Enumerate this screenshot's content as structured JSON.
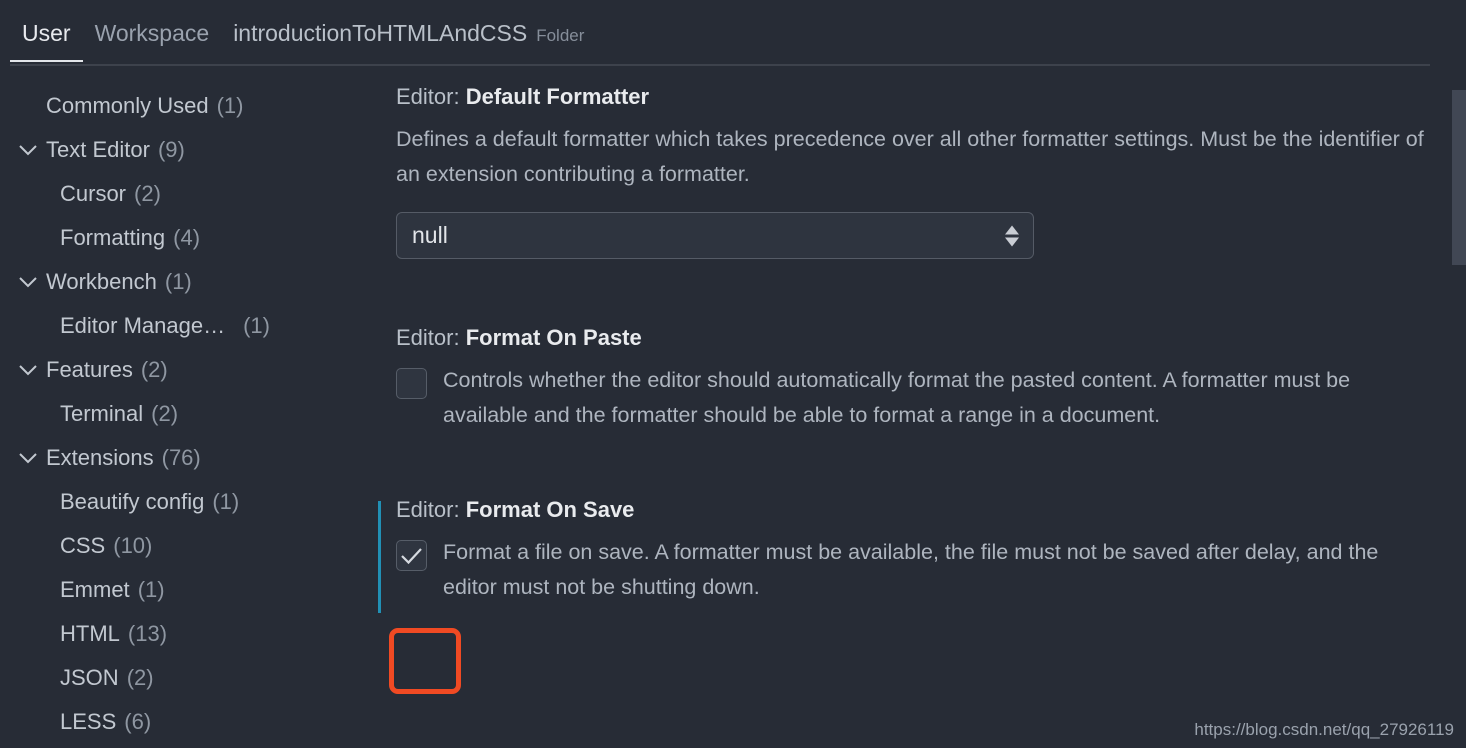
{
  "tabs": [
    {
      "label": "User",
      "active": true,
      "sub": ""
    },
    {
      "label": "Workspace",
      "active": false,
      "sub": ""
    },
    {
      "label": "introductionToHTMLAndCSS",
      "active": false,
      "sub": "Folder"
    }
  ],
  "sidebar": {
    "items": [
      {
        "label": "Commonly Used",
        "count": "(1)",
        "chevron": false,
        "child": false
      },
      {
        "label": "Text Editor",
        "count": "(9)",
        "chevron": true,
        "child": false
      },
      {
        "label": "Cursor",
        "count": "(2)",
        "chevron": false,
        "child": true
      },
      {
        "label": "Formatting",
        "count": "(4)",
        "chevron": false,
        "child": true
      },
      {
        "label": "Workbench",
        "count": "(1)",
        "chevron": true,
        "child": false
      },
      {
        "label": "Editor Manage…",
        "count": "(1)",
        "chevron": false,
        "child": true,
        "wide_gap": true
      },
      {
        "label": "Features",
        "count": "(2)",
        "chevron": true,
        "child": false
      },
      {
        "label": "Terminal",
        "count": "(2)",
        "chevron": false,
        "child": true
      },
      {
        "label": "Extensions",
        "count": "(76)",
        "chevron": true,
        "child": false
      },
      {
        "label": "Beautify config",
        "count": "(1)",
        "chevron": false,
        "child": true
      },
      {
        "label": "CSS",
        "count": "(10)",
        "chevron": false,
        "child": true
      },
      {
        "label": "Emmet",
        "count": "(1)",
        "chevron": false,
        "child": true
      },
      {
        "label": "HTML",
        "count": "(13)",
        "chevron": false,
        "child": true
      },
      {
        "label": "JSON",
        "count": "(2)",
        "chevron": false,
        "child": true
      },
      {
        "label": "LESS",
        "count": "(6)",
        "chevron": false,
        "child": true
      }
    ]
  },
  "settings": {
    "default_formatter": {
      "prefix": "Editor: ",
      "name": "Default Formatter",
      "description": "Defines a default formatter which takes precedence over all other formatter settings. Must be the identifier of an extension contributing a formatter.",
      "value": "null"
    },
    "format_on_paste": {
      "prefix": "Editor: ",
      "name": "Format On Paste",
      "description": "Controls whether the editor should automatically format the pasted content. A formatter must be available and the formatter should be able to format a range in a document.",
      "checked": false
    },
    "format_on_save": {
      "prefix": "Editor: ",
      "name": "Format On Save",
      "description": "Format a file on save. A formatter must be available, the file must not be saved after delay, and the editor must not be shutting down.",
      "checked": true
    }
  },
  "colors": {
    "background": "#272c36",
    "accent_bar": "#2190b5",
    "annotation": "#f04a23",
    "active_tab_underline": "#e3e6ea"
  },
  "watermark": "https://blog.csdn.net/qq_27926119"
}
